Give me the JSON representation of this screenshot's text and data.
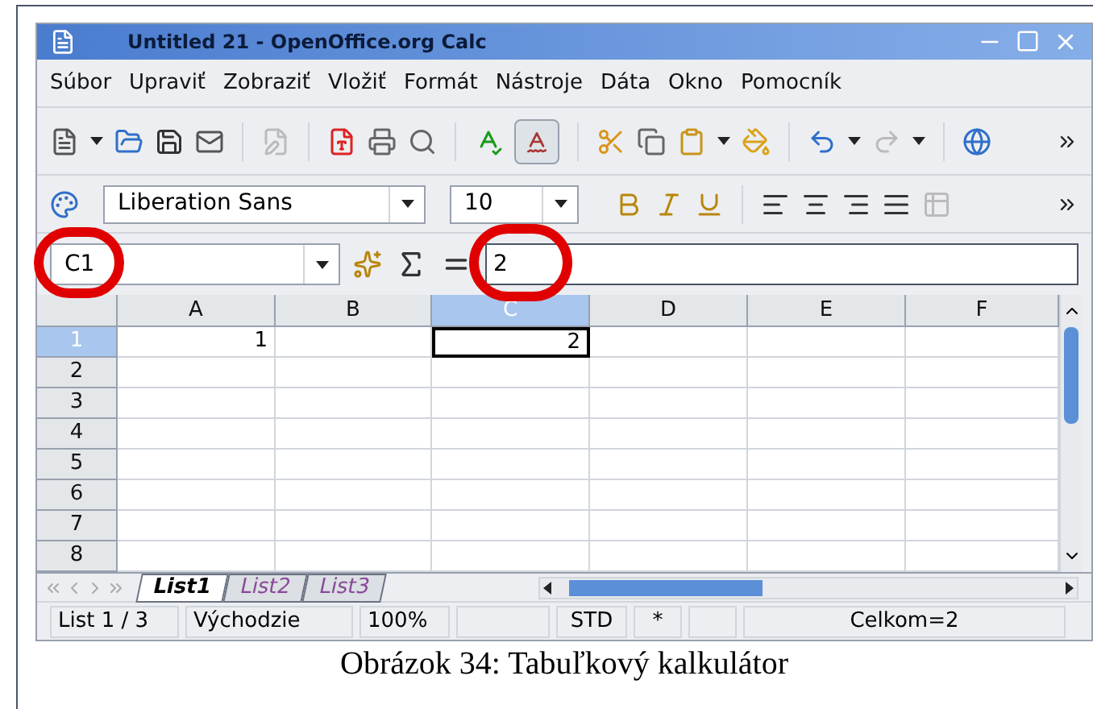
{
  "window": {
    "title": "Untitled 21 - OpenOffice.org Calc"
  },
  "menu": [
    "Súbor",
    "Upraviť",
    "Zobraziť",
    "Vložiť",
    "Formát",
    "Nástroje",
    "Dáta",
    "Okno",
    "Pomocník"
  ],
  "format_bar": {
    "font_name": "Liberation Sans",
    "font_size": "10"
  },
  "formula_bar": {
    "cell_reference": "C1",
    "value": "2"
  },
  "sheet": {
    "columns": [
      {
        "label": "A",
        "selected": false
      },
      {
        "label": "B",
        "selected": false
      },
      {
        "label": "C",
        "selected": true
      },
      {
        "label": "D",
        "selected": false
      },
      {
        "label": "E",
        "selected": false
      },
      {
        "label": "F",
        "selected": false
      }
    ],
    "rows": [
      {
        "label": "1",
        "selected": true,
        "cells": [
          {
            "value": "1",
            "active": false
          },
          {
            "active": false
          },
          {
            "value": "2",
            "active": true
          },
          {
            "active": false
          },
          {
            "active": false
          },
          {
            "active": false
          }
        ]
      },
      {
        "label": "2",
        "selected": false,
        "cells": [
          {
            "active": false
          },
          {
            "active": false
          },
          {
            "active": false
          },
          {
            "active": false
          },
          {
            "active": false
          },
          {
            "active": false
          }
        ]
      },
      {
        "label": "3",
        "selected": false,
        "cells": [
          {
            "active": false
          },
          {
            "active": false
          },
          {
            "active": false
          },
          {
            "active": false
          },
          {
            "active": false
          },
          {
            "active": false
          }
        ]
      },
      {
        "label": "4",
        "selected": false,
        "cells": [
          {
            "active": false
          },
          {
            "active": false
          },
          {
            "active": false
          },
          {
            "active": false
          },
          {
            "active": false
          },
          {
            "active": false
          }
        ]
      },
      {
        "label": "5",
        "selected": false,
        "cells": [
          {
            "active": false
          },
          {
            "active": false
          },
          {
            "active": false
          },
          {
            "active": false
          },
          {
            "active": false
          },
          {
            "active": false
          }
        ]
      },
      {
        "label": "6",
        "selected": false,
        "cells": [
          {
            "active": false
          },
          {
            "active": false
          },
          {
            "active": false
          },
          {
            "active": false
          },
          {
            "active": false
          },
          {
            "active": false
          }
        ]
      },
      {
        "label": "7",
        "selected": false,
        "cells": [
          {
            "active": false
          },
          {
            "active": false
          },
          {
            "active": false
          },
          {
            "active": false
          },
          {
            "active": false
          },
          {
            "active": false
          }
        ]
      },
      {
        "label": "8",
        "selected": false,
        "cells": [
          {
            "active": false
          },
          {
            "active": false
          },
          {
            "active": false
          },
          {
            "active": false
          },
          {
            "active": false
          },
          {
            "active": false
          }
        ]
      }
    ]
  },
  "sheet_tabs": [
    {
      "label": "List1",
      "selected": true
    },
    {
      "label": "List2",
      "selected": false
    },
    {
      "label": "List3",
      "selected": false
    }
  ],
  "status_bar": [
    {
      "kind": "text",
      "text": "List 1 / 3"
    },
    {
      "kind": "text",
      "text": "Východzie"
    },
    {
      "kind": "text",
      "text": "100%"
    },
    {
      "kind": "empty"
    },
    {
      "kind": "text",
      "text": "STD"
    },
    {
      "kind": "text",
      "text": "*"
    },
    {
      "kind": "empty"
    },
    {
      "kind": "text",
      "text": "Celkom=2"
    }
  ],
  "caption": "Obrázok 34: Tabuľkový kalkulátor"
}
